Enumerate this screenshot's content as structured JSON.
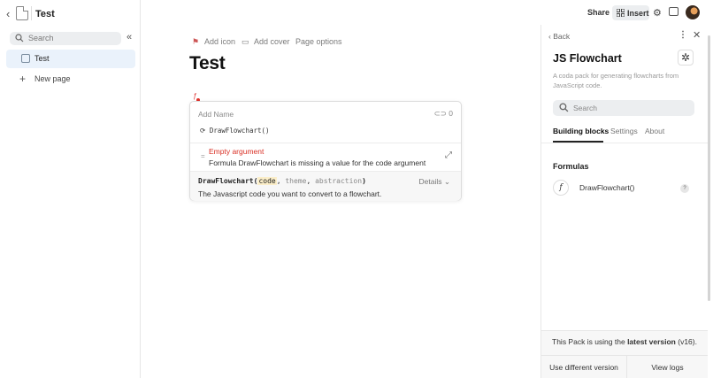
{
  "doc": {
    "title": "Test"
  },
  "sidebar": {
    "search_placeholder": "Search",
    "items": [
      {
        "label": "Test"
      }
    ],
    "new_page_label": "New page"
  },
  "page_options": {
    "add_icon": "Add icon",
    "add_cover": "Add cover",
    "page_options": "Page options"
  },
  "page_title": "Test",
  "formula_card": {
    "name_placeholder": "Add Name",
    "ref_count": "0",
    "code": "DrawFlowchart()",
    "error_title": "Empty argument",
    "error_desc": "Formula DrawFlowchart is missing a value for the code argument",
    "signature": {
      "fn": "DrawFlowchart(",
      "arg1": "code",
      "arg2": "theme",
      "arg3": "abstraction",
      "close": ")"
    },
    "details_label": "Details",
    "arg_description": "The Javascript code you want to convert to a flowchart."
  },
  "toolbar": {
    "share": "Share",
    "insert": "Insert"
  },
  "pack_panel": {
    "back": "Back",
    "title": "JS Flowchart",
    "description": "A coda pack for generating flowcharts from JavaScript code.",
    "search_placeholder": "Search",
    "tabs": [
      "Building blocks",
      "Settings",
      "About"
    ],
    "section_title": "Formulas",
    "formulas": [
      {
        "name": "DrawFlowchart()"
      }
    ],
    "version_prefix": "This Pack is using the ",
    "version_bold": "latest version",
    "version_suffix": " (v16).",
    "btn_different_version": "Use different version",
    "btn_view_logs": "View logs"
  }
}
